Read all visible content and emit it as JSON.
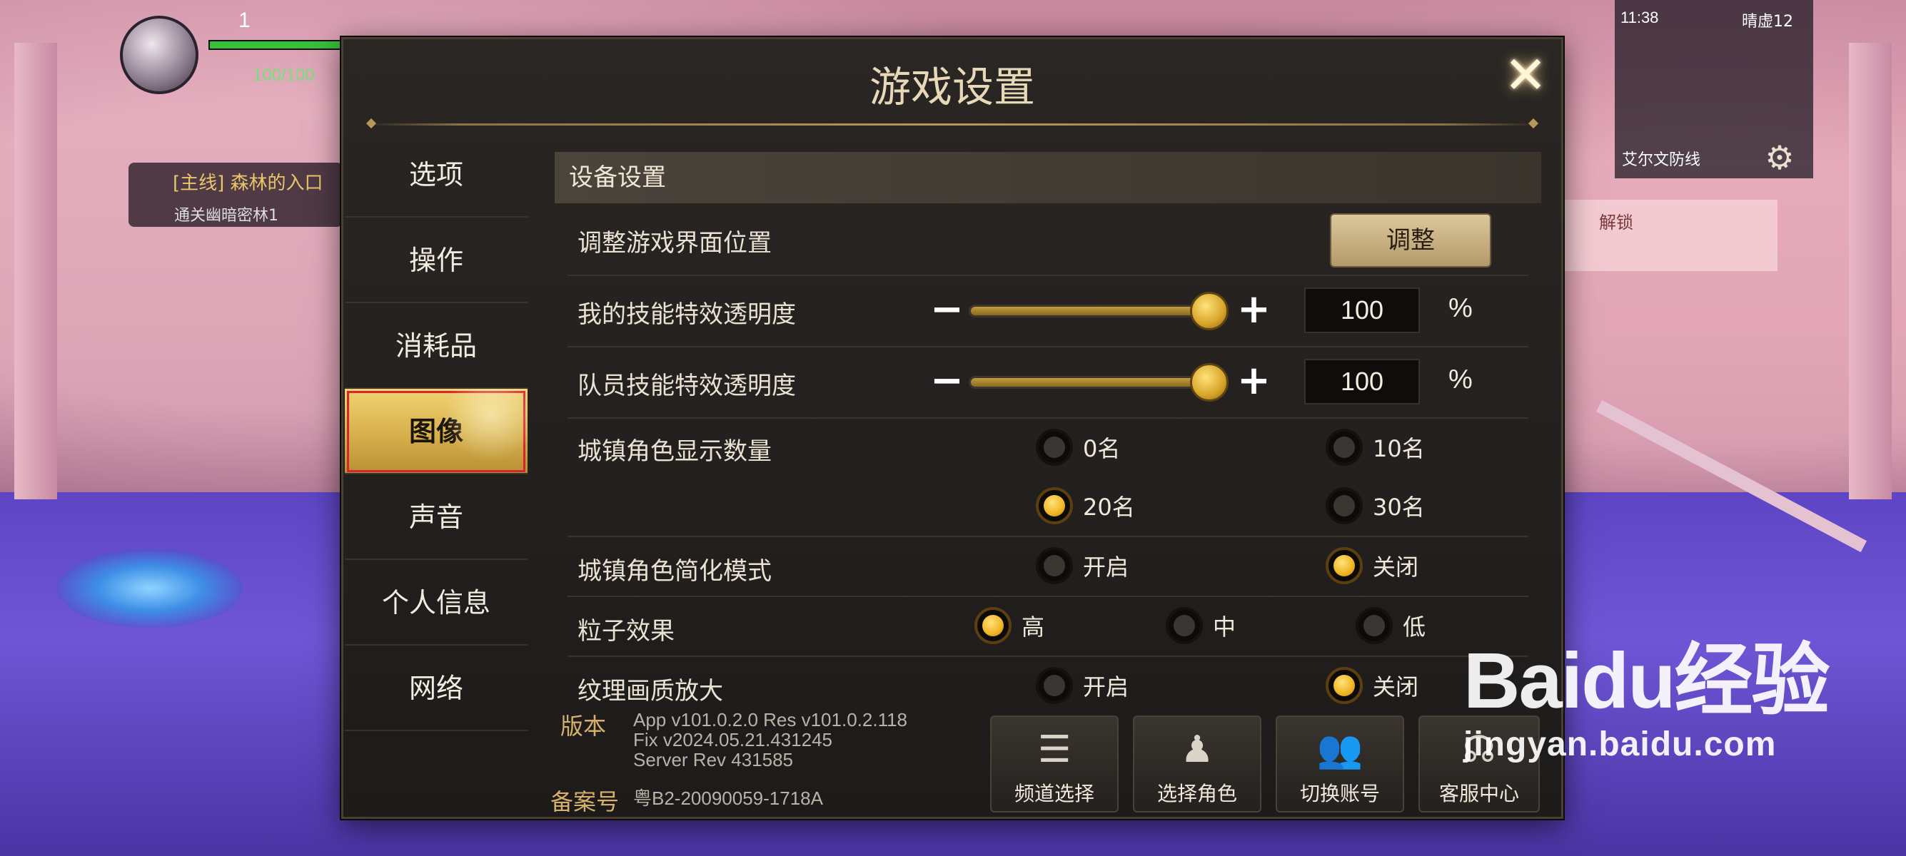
{
  "hud": {
    "level": "1",
    "hp_text": "100/100",
    "quest_title": "[主线] 森林的入口",
    "quest_sub": "通关幽暗密林1",
    "time": "11:38",
    "player_name": "晴虚12",
    "zone": "艾尔文防线",
    "unlock_text": "解锁"
  },
  "modal": {
    "title": "游戏设置",
    "close_icon": "close-x-icon"
  },
  "sidebar": {
    "items": [
      {
        "label": "选项"
      },
      {
        "label": "操作"
      },
      {
        "label": "消耗品"
      },
      {
        "label": "图像"
      },
      {
        "label": "声音"
      },
      {
        "label": "个人信息"
      },
      {
        "label": "网络"
      }
    ],
    "active_index": 3
  },
  "settings": {
    "section_title": "设备设置",
    "adjust_ui": {
      "label": "调整游戏界面位置",
      "button": "调整"
    },
    "my_skill_opacity": {
      "label": "我的技能特效透明度",
      "value": "100",
      "unit": "%",
      "minus": "−",
      "plus": "+",
      "fraction": 1.0
    },
    "team_skill_opacity": {
      "label": "队员技能特效透明度",
      "value": "100",
      "unit": "%",
      "minus": "−",
      "plus": "+",
      "fraction": 1.0
    },
    "town_char_count": {
      "label": "城镇角色显示数量",
      "options": [
        "0名",
        "10名",
        "20名",
        "30名"
      ],
      "selected": "20名"
    },
    "town_simple_mode": {
      "label": "城镇角色简化模式",
      "options": [
        "开启",
        "关闭"
      ],
      "selected": "关闭"
    },
    "particle": {
      "label": "粒子效果",
      "options": [
        "高",
        "中",
        "低"
      ],
      "selected": "高"
    },
    "texture_upscale": {
      "label": "纹理画质放大",
      "options": [
        "开启",
        "关闭"
      ],
      "selected": "关闭"
    }
  },
  "footer": {
    "version_label": "版本",
    "version_lines": [
      "App v101.0.2.0 Res v101.0.2.118",
      "Fix v2024.05.21.431245",
      "Server Rev 431585"
    ],
    "record_label": "备案号",
    "record_value": "粤B2-20090059-1718A",
    "buttons": [
      {
        "label": "频道选择",
        "icon": "list-icon"
      },
      {
        "label": "选择角色",
        "icon": "character-pin-icon"
      },
      {
        "label": "切换账号",
        "icon": "users-icon"
      },
      {
        "label": "客服中心",
        "icon": "headset-icon"
      }
    ]
  },
  "watermark": {
    "logo": "Baidu经验",
    "url": "jingyan.baidu.com"
  },
  "colors": {
    "accent_gold": "#d7b04c",
    "radio_on": "#f0b424",
    "active_outline": "#d8242c"
  }
}
